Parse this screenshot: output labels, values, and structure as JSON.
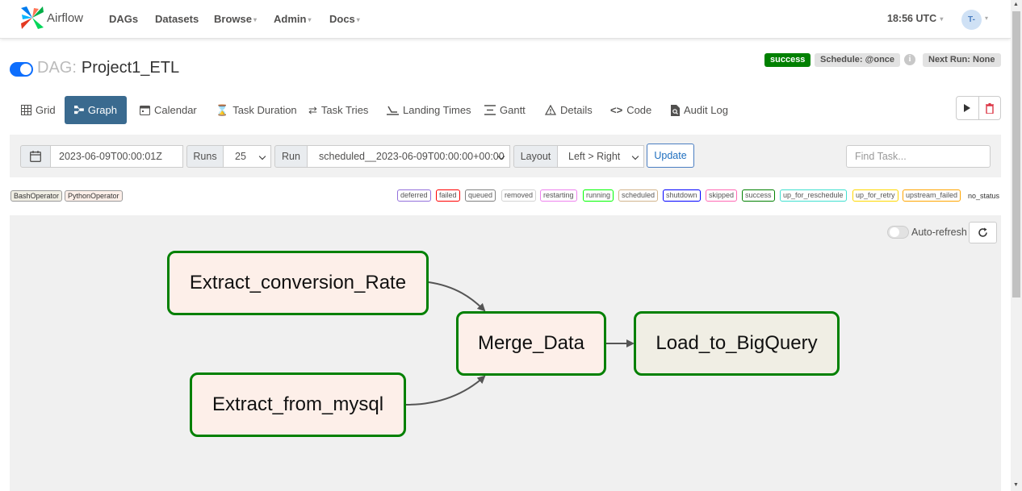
{
  "navbar": {
    "brand": "Airflow",
    "items": [
      {
        "label": "DAGs",
        "dropdown": false
      },
      {
        "label": "Datasets",
        "dropdown": false
      },
      {
        "label": "Browse",
        "dropdown": true
      },
      {
        "label": "Admin",
        "dropdown": true
      },
      {
        "label": "Docs",
        "dropdown": true
      }
    ],
    "time": "18:56 UTC",
    "avatar_initials": "T-"
  },
  "dag": {
    "prefix": "DAG:",
    "name": "Project1_ETL",
    "paused": false,
    "state_badge": "success",
    "schedule": "Schedule: @once",
    "next_run": "Next Run: None"
  },
  "tabs": [
    {
      "label": "Grid",
      "icon": "grid-icon",
      "active": false
    },
    {
      "label": "Graph",
      "icon": "graph-icon",
      "active": true
    },
    {
      "label": "Calendar",
      "icon": "calendar-icon",
      "active": false
    },
    {
      "label": "Task Duration",
      "icon": "hourglass-icon",
      "active": false
    },
    {
      "label": "Task Tries",
      "icon": "repeat-icon",
      "active": false
    },
    {
      "label": "Landing Times",
      "icon": "landing-icon",
      "active": false
    },
    {
      "label": "Gantt",
      "icon": "gantt-icon",
      "active": false
    },
    {
      "label": "Details",
      "icon": "warning-triangle-icon",
      "active": false
    },
    {
      "label": "Code",
      "icon": "code-icon",
      "active": false
    },
    {
      "label": "Audit Log",
      "icon": "file-search-icon",
      "active": false
    }
  ],
  "controls": {
    "base_date": "2023-06-09T00:00:01Z",
    "runs_label": "Runs",
    "runs_value": "25",
    "run_label": "Run",
    "run_value": "scheduled__2023-06-09T00:00:00+00:00",
    "layout_label": "Layout",
    "layout_value": "Left > Right",
    "update_label": "Update",
    "find_task_placeholder": "Find Task..."
  },
  "operators": [
    "BashOperator",
    "PythonOperator"
  ],
  "states": [
    {
      "label": "deferred",
      "color": "#9370db"
    },
    {
      "label": "failed",
      "color": "#ff0000"
    },
    {
      "label": "queued",
      "color": "#808080"
    },
    {
      "label": "removed",
      "color": "#d3d3d3"
    },
    {
      "label": "restarting",
      "color": "#ee82ee"
    },
    {
      "label": "running",
      "color": "#00ff00"
    },
    {
      "label": "scheduled",
      "color": "#d2b48c"
    },
    {
      "label": "shutdown",
      "color": "#0000ff"
    },
    {
      "label": "skipped",
      "color": "#ff69b4"
    },
    {
      "label": "success",
      "color": "#008000"
    },
    {
      "label": "up_for_reschedule",
      "color": "#40e0d0"
    },
    {
      "label": "up_for_retry",
      "color": "#ffd700"
    },
    {
      "label": "upstream_failed",
      "color": "#ffa500"
    }
  ],
  "no_status": "no_status",
  "graph": {
    "auto_refresh": "Auto-refresh",
    "nodes": [
      {
        "id": "Extract_conversion_Rate",
        "operator": "PythonOperator",
        "state": "success",
        "fill": "#fdefe9"
      },
      {
        "id": "Extract_from_mysql",
        "operator": "PythonOperator",
        "state": "success",
        "fill": "#fdefe9"
      },
      {
        "id": "Merge_Data",
        "operator": "PythonOperator",
        "state": "success",
        "fill": "#fdefe9"
      },
      {
        "id": "Load_to_BigQuery",
        "operator": "BashOperator",
        "state": "success",
        "fill": "#f0eee4"
      }
    ],
    "edges": [
      [
        "Extract_conversion_Rate",
        "Merge_Data"
      ],
      [
        "Extract_from_mysql",
        "Merge_Data"
      ],
      [
        "Merge_Data",
        "Load_to_BigQuery"
      ]
    ]
  },
  "colors": {
    "accent": "#3a6a8f",
    "success": "#008000",
    "link": "#1f6fbf"
  }
}
